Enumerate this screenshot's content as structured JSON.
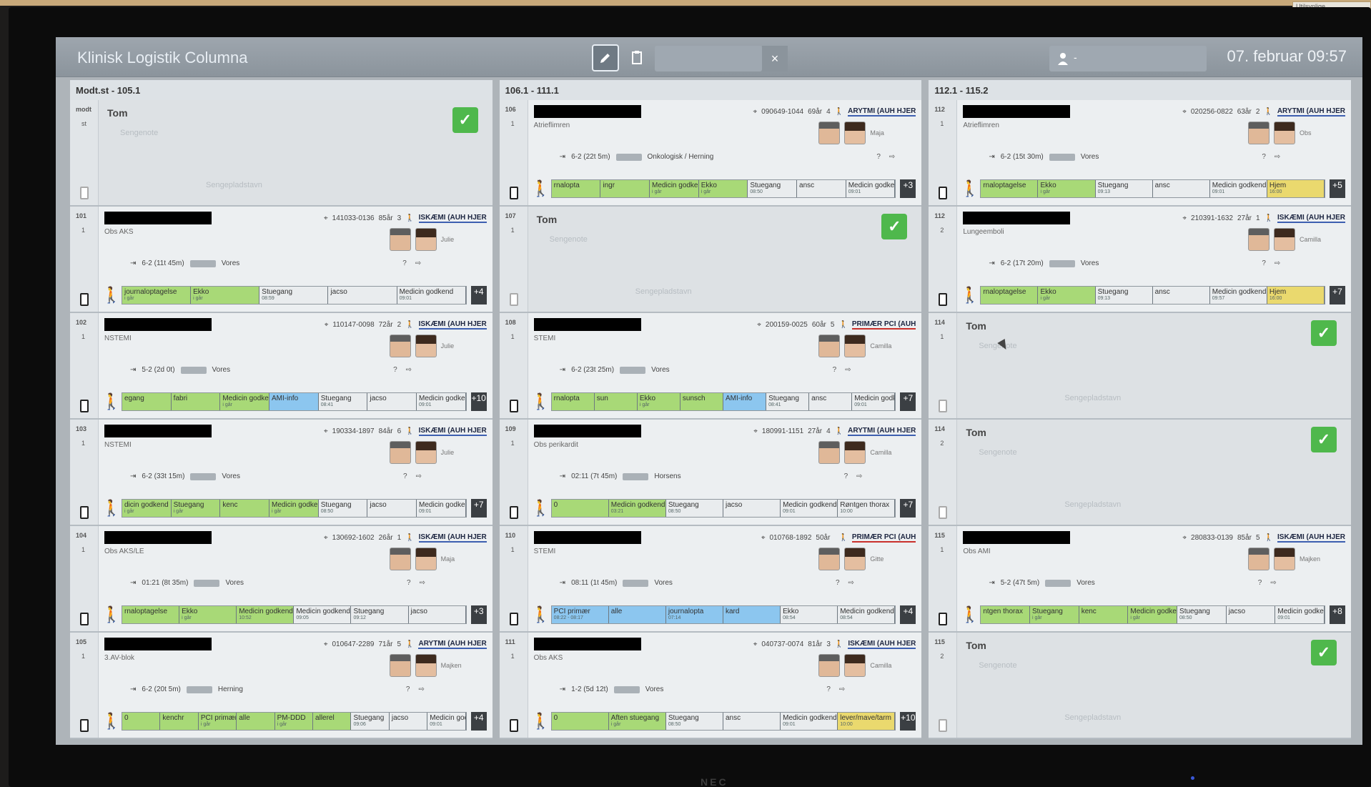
{
  "corner_sticker": "Utilsynlige...",
  "monitor_logo": "NEC",
  "header": {
    "app_title": "Klinisk Logistik Columna",
    "clear_label": "×",
    "user_separator": "-",
    "date": "07. februar",
    "time": "09:57"
  },
  "columns": [
    {
      "header": "Modt.st - 105.1",
      "beds": [
        {
          "num": "modt",
          "sub": "st",
          "empty": true,
          "tom": "Tom",
          "ph1": "Sengenote",
          "ph2": "Sengepladstavn"
        },
        {
          "num": "101",
          "sub": "1",
          "empty": false,
          "cpr": "141033-0136",
          "age": "85år",
          "count": "3",
          "ward": "ISKÆMI (AUH HJER",
          "wardColor": "blue",
          "diag": "Obs AKS",
          "staffName": "Julie",
          "los": "6-2 (11t 45m)",
          "dest": "Vores",
          "tasks": [
            [
              "journaloptagelse",
              "i går",
              "green"
            ],
            [
              "Ekko",
              "i går",
              "green"
            ],
            [
              "Stuegang",
              "08:59",
              "plain"
            ],
            [
              "jacso",
              "",
              "plain"
            ],
            [
              "Medicin godkend",
              "09:01",
              "plain"
            ]
          ],
          "plus": "+4"
        },
        {
          "num": "102",
          "sub": "1",
          "empty": false,
          "cpr": "110147-0098",
          "age": "72år",
          "count": "2",
          "ward": "ISKÆMI (AUH HJER",
          "wardColor": "blue",
          "diag": "NSTEMI",
          "staffName": "Julie",
          "los": "5-2 (2d 0t)",
          "dest": "Vores",
          "tasks": [
            [
              "egang",
              "",
              "green"
            ],
            [
              "fabri",
              "",
              "green"
            ],
            [
              "Medicin godkend",
              "i går",
              "green"
            ],
            [
              "AMI-info",
              "",
              "blue"
            ],
            [
              "Stuegang",
              "08:41",
              "plain"
            ],
            [
              "jacso",
              "",
              "plain"
            ],
            [
              "Medicin godkend",
              "09:01",
              "plain"
            ]
          ],
          "plus": "+10"
        },
        {
          "num": "103",
          "sub": "1",
          "empty": false,
          "cpr": "190334-1897",
          "age": "84år",
          "count": "6",
          "ward": "ISKÆMI (AUH HJER",
          "wardColor": "blue",
          "diag": "NSTEMI",
          "staffName": "Julie",
          "los": "6-2 (33t 15m)",
          "dest": "Vores",
          "tasks": [
            [
              "dicin godkend",
              "i går",
              "green"
            ],
            [
              "Stuegang",
              "i går",
              "green"
            ],
            [
              "kenc",
              "",
              "green"
            ],
            [
              "Medicin godkend",
              "i går",
              "green"
            ],
            [
              "Stuegang",
              "08:50",
              "plain"
            ],
            [
              "jacso",
              "",
              "plain"
            ],
            [
              "Medicin godkend",
              "09:01",
              "plain"
            ]
          ],
          "plus": "+7"
        },
        {
          "num": "104",
          "sub": "1",
          "empty": false,
          "cpr": "130692-1602",
          "age": "26år",
          "count": "1",
          "ward": "ISKÆMI (AUH HJER",
          "wardColor": "blue",
          "diag": "Obs AKS/LE",
          "staffName": "Maja",
          "los": "01:21 (8t 35m)",
          "dest": "Vores",
          "tasks": [
            [
              "rnaloptagelse",
              "",
              "green"
            ],
            [
              "Ekko",
              "i går",
              "green"
            ],
            [
              "Medicin godkend",
              "10:52",
              "green"
            ],
            [
              "Medicin godkend",
              "09:05",
              "plain"
            ],
            [
              "Stuegang",
              "09:12",
              "plain"
            ],
            [
              "jacso",
              "",
              "plain"
            ]
          ],
          "plus": "+3"
        },
        {
          "num": "105",
          "sub": "1",
          "empty": false,
          "cpr": "010647-2289",
          "age": "71år",
          "count": "5",
          "ward": "ARYTMI (AUH HJER",
          "wardColor": "blue",
          "diag": "3.AV-blok",
          "staffName": "Majken",
          "los": "6-2 (20t 5m)",
          "dest": "Herning",
          "tasks": [
            [
              "0",
              "",
              "green"
            ],
            [
              "kenchr",
              "",
              "green"
            ],
            [
              "PCI primær",
              "i går",
              "green"
            ],
            [
              "alle",
              "",
              "green"
            ],
            [
              "PM-DDD",
              "i går",
              "green"
            ],
            [
              "allerel",
              "",
              "green"
            ],
            [
              "Stuegang",
              "09:06",
              "plain"
            ],
            [
              "jacso",
              "",
              "plain"
            ],
            [
              "Medicin godkend",
              "09:01",
              "plain"
            ]
          ],
          "plus": "+4"
        }
      ]
    },
    {
      "header": "106.1 - 111.1",
      "beds": [
        {
          "num": "106",
          "sub": "1",
          "empty": false,
          "cpr": "090649-1044",
          "age": "69år",
          "count": "4",
          "ward": "ARYTMI (AUH HJER",
          "wardColor": "blue",
          "diag": "Atrieflimren",
          "staffName": "Maja",
          "los": "6-2 (22t 5m)",
          "dest": "Onkologisk / Herning",
          "tasks": [
            [
              "rnalopta",
              "",
              "green"
            ],
            [
              "ingr",
              "",
              "green"
            ],
            [
              "Medicin godkend",
              "i går",
              "green"
            ],
            [
              "Ekko",
              "i går",
              "green"
            ],
            [
              "Stuegang",
              "08:50",
              "plain"
            ],
            [
              "ansc",
              "",
              "plain"
            ],
            [
              "Medicin godkend",
              "09:01",
              "plain"
            ]
          ],
          "plus": "+3"
        },
        {
          "num": "107",
          "sub": "1",
          "empty": true,
          "tom": "Tom",
          "ph1": "Sengenote",
          "ph2": "Sengepladstavn"
        },
        {
          "num": "108",
          "sub": "1",
          "empty": false,
          "cpr": "200159-0025",
          "age": "60år",
          "count": "5",
          "ward": "PRIMÆR PCI (AUH",
          "wardColor": "red",
          "diag": "STEMI",
          "staffName": "Camilla",
          "los": "6-2 (23t 25m)",
          "dest": "Vores",
          "tasks": [
            [
              "rnalopta",
              "",
              "green"
            ],
            [
              "sun",
              "",
              "green"
            ],
            [
              "Ekko",
              "i går",
              "green"
            ],
            [
              "sunsch",
              "",
              "green"
            ],
            [
              "AMI-info",
              "",
              "blue"
            ],
            [
              "Stuegang",
              "08:41",
              "plain"
            ],
            [
              "ansc",
              "",
              "plain"
            ],
            [
              "Medicin godkend",
              "09:01",
              "plain"
            ]
          ],
          "plus": "+7"
        },
        {
          "num": "109",
          "sub": "1",
          "empty": false,
          "cpr": "180991-1151",
          "age": "27år",
          "count": "4",
          "ward": "ARYTMI (AUH HJER",
          "wardColor": "blue",
          "diag": "Obs perikardit",
          "staffName": "Camilla",
          "los": "02:11 (7t 45m)",
          "dest": "Horsens",
          "tasks": [
            [
              "0",
              "",
              "green"
            ],
            [
              "Medicin godkend",
              "03:21",
              "green"
            ],
            [
              "Stuegang",
              "08:50",
              "plain"
            ],
            [
              "jacso",
              "",
              "plain"
            ],
            [
              "Medicin godkend",
              "09:01",
              "plain"
            ],
            [
              "Røntgen thorax",
              "10:00",
              "plain"
            ]
          ],
          "plus": "+7"
        },
        {
          "num": "110",
          "sub": "1",
          "empty": false,
          "cpr": "010768-1892",
          "age": "50år",
          "count": "",
          "ward": "PRIMÆR PCI (AUH",
          "wardColor": "red",
          "diag": "STEMI",
          "staffName": "Gitte",
          "los": "08:11 (1t 45m)",
          "dest": "Vores",
          "tasks": [
            [
              "PCI primær",
              "08:22 - 08:17",
              "blue"
            ],
            [
              "alle",
              "",
              "blue"
            ],
            [
              "journalopta",
              "07:14",
              "blue"
            ],
            [
              "kard",
              "",
              "blue"
            ],
            [
              "Ekko",
              "08:54",
              "plain"
            ],
            [
              "Medicin godkend",
              "08:54",
              "plain"
            ]
          ],
          "plus": "+4"
        },
        {
          "num": "111",
          "sub": "1",
          "empty": false,
          "cpr": "040737-0074",
          "age": "81år",
          "count": "3",
          "ward": "ISKÆMI (AUH HJER",
          "wardColor": "blue",
          "diag": "Obs AKS",
          "staffName": "Camilla",
          "los": "1-2 (5d 12t)",
          "dest": "Vores",
          "tasks": [
            [
              "0",
              "",
              "green"
            ],
            [
              "Aften stuegang",
              "i går",
              "green"
            ],
            [
              "Stuegang",
              "08:50",
              "plain"
            ],
            [
              "ansc",
              "",
              "plain"
            ],
            [
              "Medicin godkend",
              "09:01",
              "plain"
            ],
            [
              "lever/mave/tarm",
              "10:00",
              "yellow"
            ]
          ],
          "plus": "+10"
        }
      ]
    },
    {
      "header": "112.1 - 115.2",
      "beds": [
        {
          "num": "112",
          "sub": "1",
          "empty": false,
          "cpr": "020256-0822",
          "age": "63år",
          "count": "2",
          "ward": "ARYTMI (AUH HJER",
          "wardColor": "blue",
          "diag": "Atrieflimren",
          "staffName": "Obs",
          "los": "6-2 (15t 30m)",
          "dest": "Vores",
          "tasks": [
            [
              "rnaloptagelse",
              "",
              "green"
            ],
            [
              "Ekko",
              "i går",
              "green"
            ],
            [
              "Stuegang",
              "09:13",
              "plain"
            ],
            [
              "ansc",
              "",
              "plain"
            ],
            [
              "Medicin godkend",
              "09:01",
              "plain"
            ],
            [
              "Hjem",
              "16:00",
              "yellow"
            ]
          ],
          "plus": "+5"
        },
        {
          "num": "112",
          "sub": "2",
          "empty": false,
          "cpr": "210391-1632",
          "age": "27år",
          "count": "1",
          "ward": "ISKÆMI (AUH HJER",
          "wardColor": "blue",
          "diag": "Lungeemboli",
          "staffName": "Camilla",
          "los": "6-2 (17t 20m)",
          "dest": "Vores",
          "tasks": [
            [
              "rnaloptagelse",
              "",
              "green"
            ],
            [
              "Ekko",
              "i går",
              "green"
            ],
            [
              "Stuegang",
              "09:13",
              "plain"
            ],
            [
              "ansc",
              "",
              "plain"
            ],
            [
              "Medicin godkend",
              "09:57",
              "plain"
            ],
            [
              "Hjem",
              "16:00",
              "yellow"
            ]
          ],
          "plus": "+7"
        },
        {
          "num": "114",
          "sub": "1",
          "empty": true,
          "tom": "Tom",
          "ph1": "Sengenote",
          "ph2": "Sengepladstavn"
        },
        {
          "num": "114",
          "sub": "2",
          "empty": true,
          "tom": "Tom",
          "ph1": "Sengenote",
          "ph2": "Sengepladstavn"
        },
        {
          "num": "115",
          "sub": "1",
          "empty": false,
          "cpr": "280833-0139",
          "age": "85år",
          "count": "5",
          "ward": "ISKÆMI (AUH HJER",
          "wardColor": "blue",
          "diag": "Obs AMI",
          "staffName": "Majken",
          "los": "5-2 (47t 5m)",
          "dest": "Vores",
          "tasks": [
            [
              "ntgen thorax",
              "",
              "green"
            ],
            [
              "Stuegang",
              "i går",
              "green"
            ],
            [
              "kenc",
              "",
              "green"
            ],
            [
              "Medicin godkend",
              "i går",
              "green"
            ],
            [
              "Stuegang",
              "08:50",
              "plain"
            ],
            [
              "jacso",
              "",
              "plain"
            ],
            [
              "Medicin godkend",
              "09:01",
              "plain"
            ]
          ],
          "plus": "+8"
        },
        {
          "num": "115",
          "sub": "2",
          "empty": true,
          "tom": "Tom",
          "ph1": "Sengenote",
          "ph2": "Sengepladstavn"
        }
      ]
    }
  ]
}
